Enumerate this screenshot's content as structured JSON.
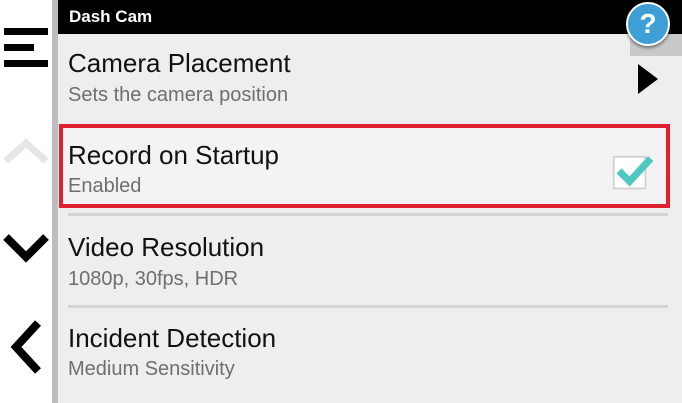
{
  "header": {
    "title": "Dash Cam",
    "help_label": "?"
  },
  "nav": {
    "icons": [
      "menu-icon",
      "chevron-up-icon",
      "chevron-down-icon",
      "chevron-left-icon"
    ]
  },
  "settings": [
    {
      "title": "Camera Placement",
      "subtitle": "Sets the camera position",
      "control": "arrow-right-icon"
    },
    {
      "title": "Record on Startup",
      "subtitle": "Enabled",
      "control": "checkbox",
      "checked": true,
      "highlighted": true
    },
    {
      "title": "Video Resolution",
      "subtitle": "1080p, 30fps, HDR"
    },
    {
      "title": "Incident Detection",
      "subtitle": "Medium Sensitivity"
    }
  ],
  "colors": {
    "title_bar": "#000000",
    "panel_bg": "#eeeeee",
    "highlight_border": "#e02030",
    "check_color": "#4ec8c0",
    "help_button": "#3d9fd6"
  }
}
